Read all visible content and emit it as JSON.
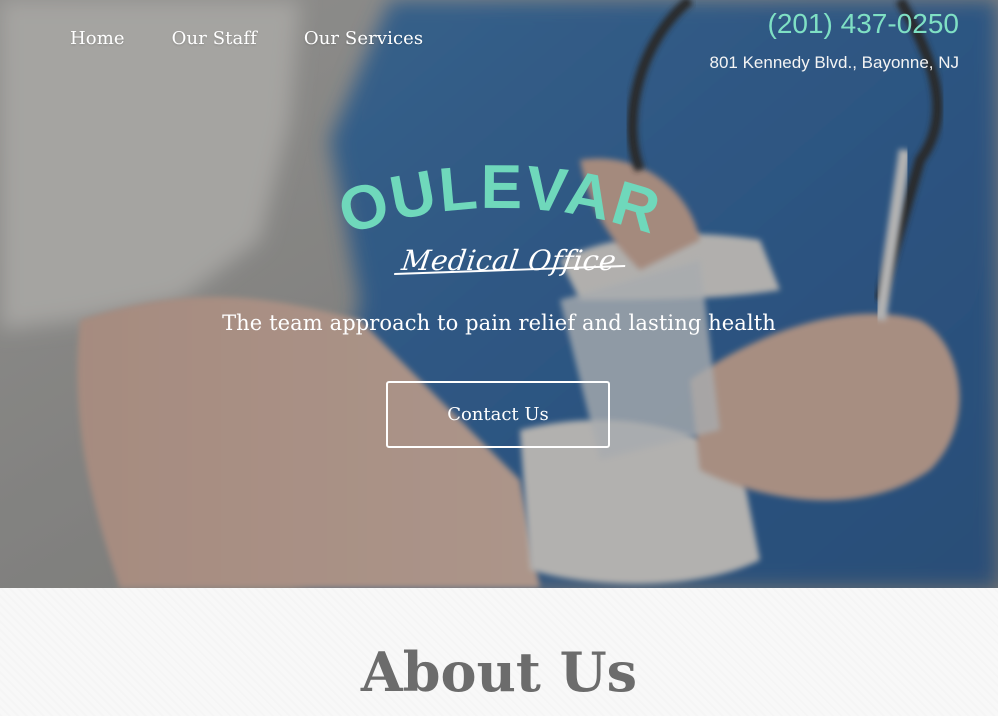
{
  "nav": {
    "items": [
      {
        "label": "Home"
      },
      {
        "label": "Our Staff"
      },
      {
        "label": "Our Services"
      }
    ]
  },
  "contact": {
    "phone": "(201) 437-0250",
    "address": "801 Kennedy Blvd., Bayonne, NJ"
  },
  "hero": {
    "logo_title": "BOULEVARD",
    "logo_subtitle": "Medical Office",
    "tagline": "The team approach to pain relief and lasting health",
    "cta_label": "Contact Us"
  },
  "about": {
    "heading": "About Us"
  },
  "colors": {
    "accent": "#6fd8bb",
    "phone": "#7fe0c4",
    "heading": "#6c6c6c"
  }
}
